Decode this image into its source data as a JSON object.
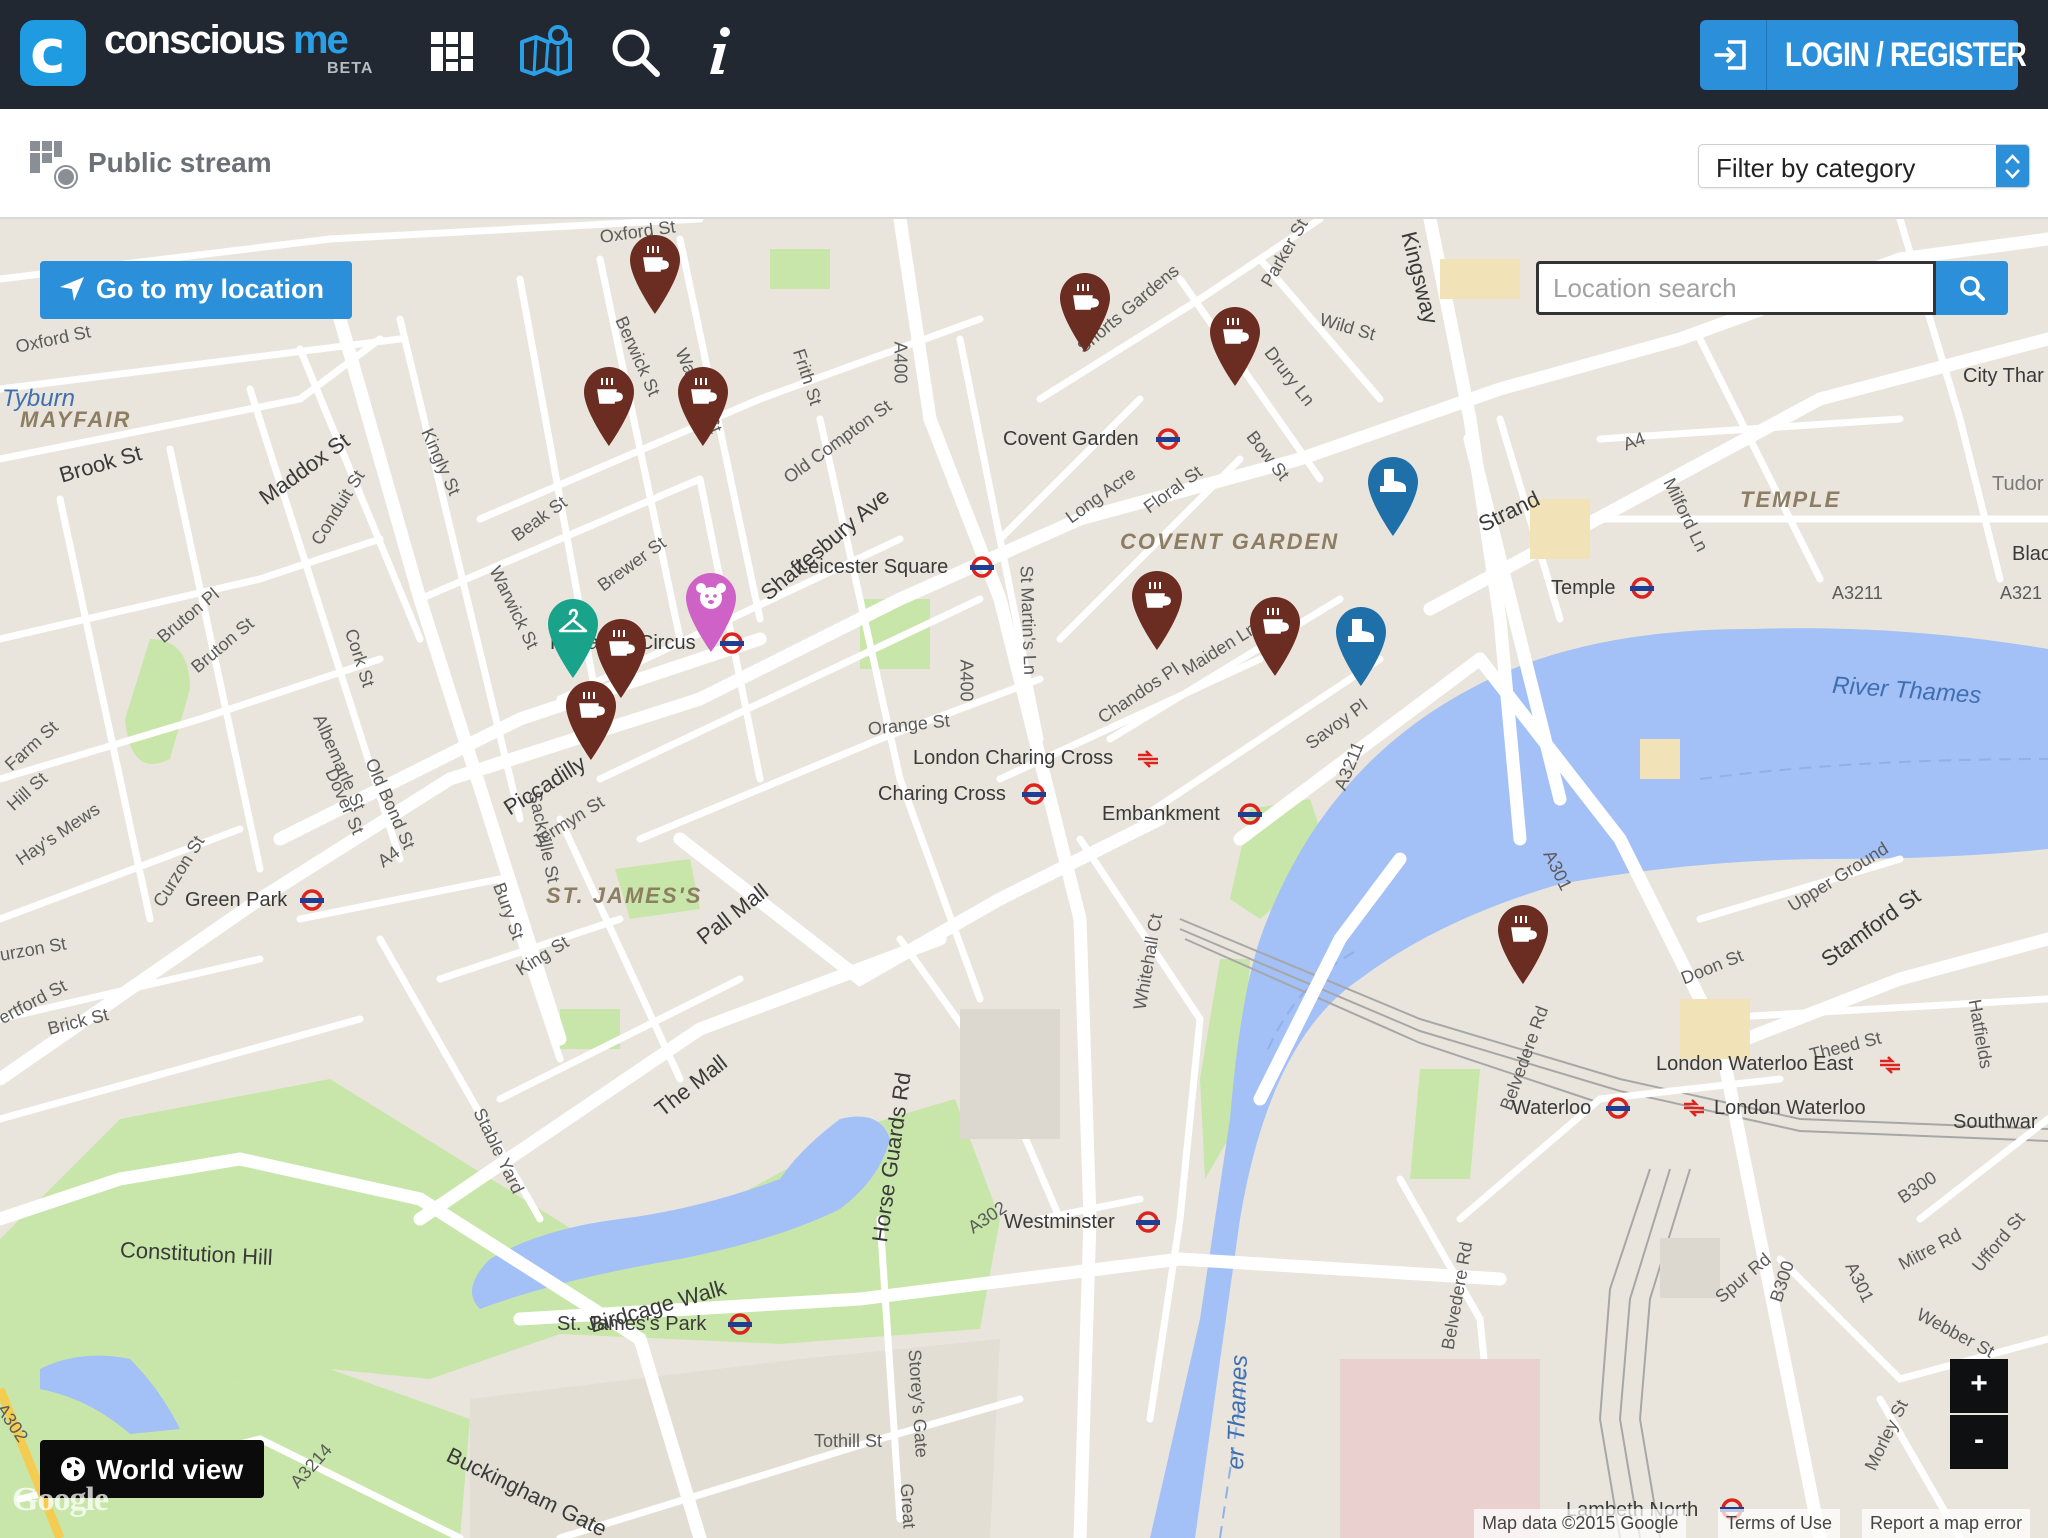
{
  "header": {
    "brand_conscious": "conscious",
    "brand_me": "me",
    "beta": "BETA",
    "login_label": "LOGIN / REGISTER",
    "nav_icons": [
      "grid-icon",
      "map-icon",
      "search-icon",
      "info-icon"
    ]
  },
  "subheader": {
    "title": "Public stream",
    "filter_label": "Filter by category"
  },
  "map": {
    "go_location_label": "Go to my location",
    "search_placeholder": "Location search",
    "world_view_label": "World view",
    "zoom_in": "+",
    "zoom_out": "-",
    "attribution": [
      "Map data ©2015 Google",
      "Terms of Use",
      "Report a map error"
    ],
    "google_logo": "Google",
    "stations": [
      "Covent Garden",
      "Leicester Square",
      "Piccadilly Circus",
      "Temple",
      "London Charing Cross",
      "Charing Cross",
      "Embankment",
      "Green Park",
      "Westminster",
      "St. James's Park",
      "London Waterloo East",
      "Waterloo",
      "London Waterloo",
      "Lambeth North"
    ],
    "areas": [
      "MAYFAIR",
      "COVENT GARDEN",
      "ST. JAMES'S",
      "TEMPLE"
    ],
    "places": [
      "Tyburn",
      "City Thar",
      "Tudor S",
      "Blac",
      "Southwar"
    ],
    "river_labels": [
      "River Thames",
      "er Thames"
    ],
    "road_labels": [
      "A4",
      "A400",
      "A3211",
      "A301",
      "B300",
      "A302",
      "A3214",
      "A321",
      "A3211"
    ],
    "streets": [
      "Oxford St",
      "Brook St",
      "Maddox St",
      "Conduit St",
      "Bruton Pl",
      "Bruton St",
      "Farm St",
      "Hill St",
      "Hay's Mews",
      "Curzon St",
      "urzon St",
      "ertford St",
      "Brick St",
      "Cork St",
      "Albemarle St",
      "Dover St",
      "Old Bond St",
      "Kingly St",
      "Beak St",
      "Warwick St",
      "Brewer St",
      "Berwick St",
      "Wardour St",
      "Frith St",
      "Old Compton St",
      "Shaftesbury Ave",
      "Sackville St",
      "Piccadilly",
      "Jermyn St",
      "Bury St",
      "King St",
      "Pall Mall",
      "The Mall",
      "Stable Yard",
      "Constitution Hill",
      "Birdcage Walk",
      "Buckingham Gate",
      "Horse Guards Rd",
      "Storey's Gate",
      "Tothill St",
      "Orange St",
      "St Martin's Ln",
      "Long Acre",
      "Floral St",
      "Chandos Pl",
      "Maiden Ln",
      "Shorts Gardens",
      "Parker St",
      "Drury Ln",
      "Wild St",
      "Bow St",
      "Kingsway",
      "Strand",
      "Savoy Pl",
      "Milford Ln",
      "Whitehall Ct",
      "Belvedere Rd",
      "Upper Ground",
      "Doon St",
      "Stamford St",
      "Theed St",
      "Hatfields",
      "Mitre Rd",
      "Ufford St",
      "Webber St",
      "Spur Rd",
      "Morley St",
      "Great"
    ],
    "pins": [
      {
        "category": "coffee",
        "color": "#6b2d21"
      },
      {
        "category": "coffee",
        "color": "#6b2d21"
      },
      {
        "category": "coffee",
        "color": "#6b2d21"
      },
      {
        "category": "coffee",
        "color": "#6b2d21"
      },
      {
        "category": "coffee",
        "color": "#6b2d21"
      },
      {
        "category": "coffee",
        "color": "#6b2d21"
      },
      {
        "category": "coffee",
        "color": "#6b2d21"
      },
      {
        "category": "coffee",
        "color": "#6b2d21"
      },
      {
        "category": "coffee",
        "color": "#6b2d21"
      },
      {
        "category": "coffee",
        "color": "#6b2d21"
      },
      {
        "category": "fashion",
        "color": "#1aa38b"
      },
      {
        "category": "kids",
        "color": "#cf62c7"
      },
      {
        "category": "footwear",
        "color": "#1f6fa8"
      },
      {
        "category": "footwear",
        "color": "#1f6fa8"
      }
    ]
  },
  "colors": {
    "topbar": "#222831",
    "accent": "#2b8fd9",
    "water": "#a3c0f7",
    "park": "#c8e6a9",
    "pin_coffee": "#6b2d21"
  }
}
